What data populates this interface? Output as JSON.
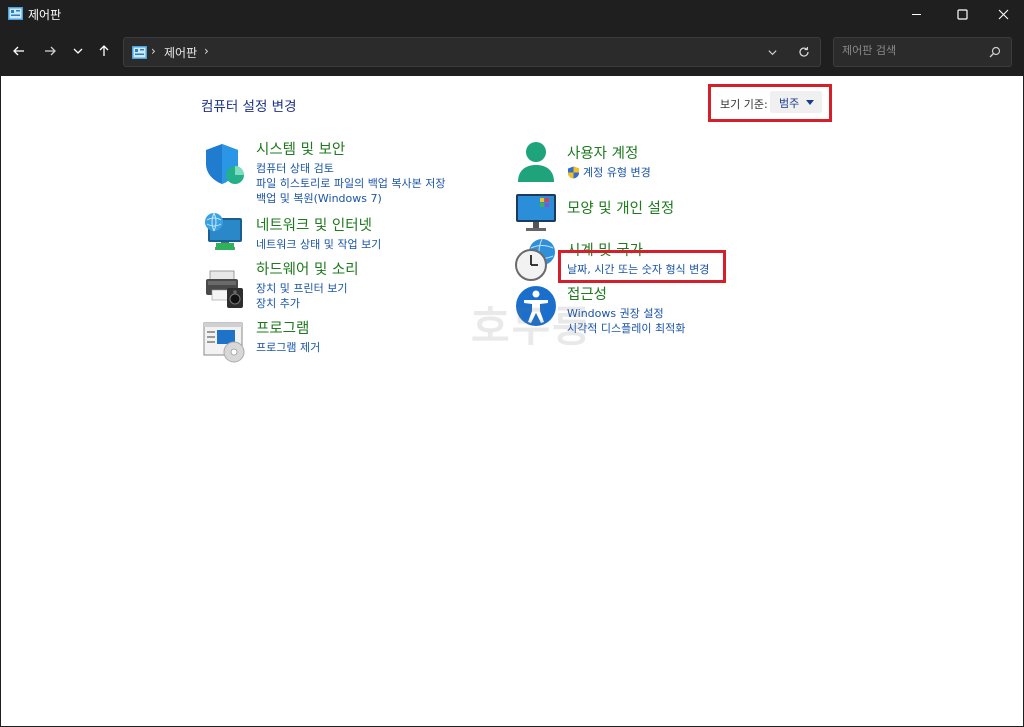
{
  "window": {
    "title": "제어판",
    "minimize_icon": "minimize-icon",
    "maximize_icon": "maximize-icon",
    "close_icon": "close-icon"
  },
  "nav": {
    "breadcrumb": [
      "제어판"
    ],
    "search_placeholder": "제어판 검색"
  },
  "content": {
    "heading": "컴퓨터 설정 변경",
    "view_by_label": "보기 기준:",
    "view_by_value": "범주",
    "watermark": "호두룽"
  },
  "categories_left": [
    {
      "title": "시스템 및 보안",
      "links": [
        "컴퓨터 상태 검토",
        "파일 히스토리로 파일의 백업 복사본 저장",
        "백업 및 복원(Windows 7)"
      ],
      "icon": "shield-icon"
    },
    {
      "title": "네트워크 및 인터넷",
      "links": [
        "네트워크 상태 및 작업 보기"
      ],
      "icon": "network-globe-icon"
    },
    {
      "title": "하드웨어 및 소리",
      "links": [
        "장치 및 프린터 보기",
        "장치 추가"
      ],
      "icon": "printer-speaker-icon"
    },
    {
      "title": "프로그램",
      "links": [
        "프로그램 제거"
      ],
      "icon": "programs-icon"
    }
  ],
  "categories_right": [
    {
      "title": "사용자 계정",
      "links": [
        "계정 유형 변경"
      ],
      "icon": "user-icon"
    },
    {
      "title": "모양 및 개인 설정",
      "links": [],
      "icon": "monitor-icon"
    },
    {
      "title": "시계 및 국가",
      "links": [
        "날짜, 시간 또는 숫자 형식 변경"
      ],
      "icon": "clock-globe-icon"
    },
    {
      "title": "접근성",
      "links": [
        "Windows 권장 설정",
        "시각적 디스플레이 최적화"
      ],
      "icon": "accessibility-icon"
    }
  ],
  "colors": {
    "accent_title": "#1f7a1f",
    "link": "#1a55a8",
    "highlight": "#d5202c"
  }
}
